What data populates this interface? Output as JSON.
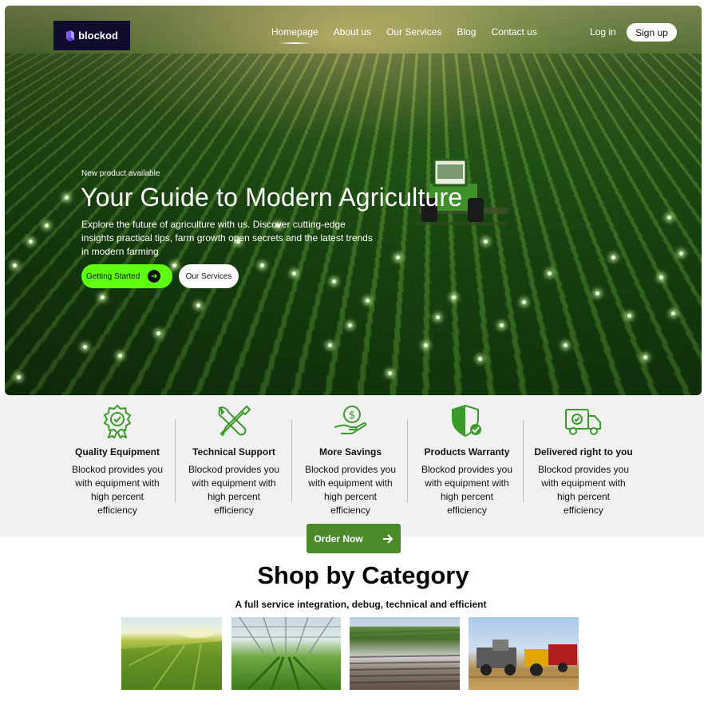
{
  "brand": {
    "name": "blockod"
  },
  "nav": {
    "items": [
      "Homepage",
      "About us",
      "Our Services",
      "Blog",
      "Contact us"
    ],
    "active": "Homepage",
    "login": "Log in",
    "signup": "Sign up"
  },
  "hero": {
    "eyebrow": "New product available",
    "title": "Your Guide to Modern Agriculture",
    "description": "Explore the future of agriculture with us. Discover cutting-edge insights practical tips, farm growth open secrets and the latest trends in modern farming",
    "primary_button": "Getting Started",
    "secondary_button": "Our Services"
  },
  "features": [
    {
      "icon": "award-badge-icon",
      "title": "Quality Equipment",
      "description": "Blockod provides you with equipment with high percent efficiency"
    },
    {
      "icon": "wrench-screwdriver-icon",
      "title": "Technical Support",
      "description": "Blockod provides you with equipment with high percent efficiency"
    },
    {
      "icon": "money-hand-icon",
      "title": "More Savings",
      "description": "Blockod provides you with equipment with high percent efficiency"
    },
    {
      "icon": "shield-check-icon",
      "title": "Products Warranty",
      "description": "Blockod provides you with equipment with high percent efficiency"
    },
    {
      "icon": "delivery-truck-icon",
      "title": "Delivered right to you",
      "description": "Blockod provides you with equipment with high percent efficiency"
    }
  ],
  "order_button": "Order Now",
  "shop": {
    "title": "Shop by Category",
    "subtitle": "A full service integration, debug, technical and efficient",
    "categories": [
      "irrigation-field-image",
      "greenhouse-image",
      "plowed-field-image",
      "combine-harvester-image"
    ]
  },
  "colors": {
    "accent_green": "#5dff0f",
    "icon_green": "#3a9a2a",
    "order_green": "#4a8a2a",
    "logo_bg": "#0f0c2e"
  }
}
